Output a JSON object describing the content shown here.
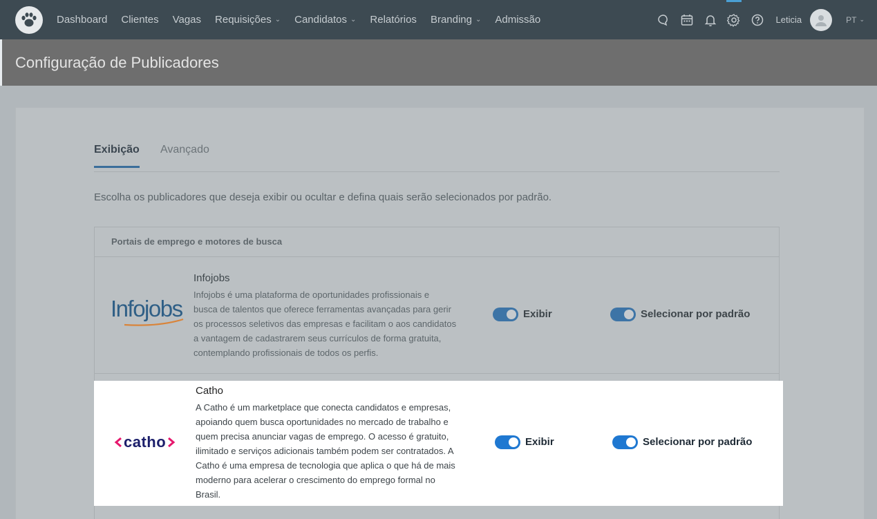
{
  "nav": {
    "items": [
      {
        "label": "Dashboard",
        "dropdown": false
      },
      {
        "label": "Clientes",
        "dropdown": false
      },
      {
        "label": "Vagas",
        "dropdown": false
      },
      {
        "label": "Requisições",
        "dropdown": true
      },
      {
        "label": "Candidatos",
        "dropdown": true
      },
      {
        "label": "Relatórios",
        "dropdown": false
      },
      {
        "label": "Branding",
        "dropdown": true
      },
      {
        "label": "Admissão",
        "dropdown": false
      }
    ],
    "icons": [
      "chat-icon",
      "calendar-icon",
      "bell-icon",
      "gear-icon",
      "help-icon"
    ],
    "user_name": "Leticia",
    "language": "PT"
  },
  "page": {
    "title": "Configuração de Publicadores"
  },
  "tabs": {
    "active": "Exibição",
    "inactive": "Avançado"
  },
  "description": "Escolha os publicadores que deseja exibir ou ocultar e defina quais serão selecionados por padrão.",
  "section": {
    "title": "Portais de emprego e motores de busca",
    "publishers": [
      {
        "name": "Infojobs",
        "logo_text": "Infojobs",
        "description_lines": [
          "Infojobs é uma plataforma de oportunidades profissionais e",
          "busca de talentos que oferece ferramentas avançadas para gerir",
          "os processos seletivos das empresas e facilitam o aos candidatos",
          "a vantagem de cadastrarem seus currículos de forma gratuita,",
          "contemplando profissionais de todos os perfis."
        ],
        "show_label": "Exibir",
        "show_on": true,
        "default_label": "Selecionar por padrão",
        "default_on": true
      },
      {
        "name": "Catho",
        "logo_text": "catho",
        "description_lines": [
          "A Catho é um marketplace que conecta candidatos e empresas,",
          "apoiando quem busca oportunidades no mercado de trabalho e",
          "quem precisa anunciar vagas de emprego. O acesso é gratuito,",
          "ilimitado e serviços adicionais também podem ser contratados. A",
          "Catho é uma empresa de tecnologia que aplica o que há de mais",
          "moderno para acelerar o crescimento do emprego formal no",
          "Brasil."
        ],
        "show_label": "Exibir",
        "show_on": true,
        "default_label": "Selecionar por padrão",
        "default_on": true
      }
    ]
  },
  "colors": {
    "nav_bg": "#3d4a52",
    "accent_blue": "#1f78d1",
    "catho_pink": "#e6186d",
    "catho_navy": "#1c1f6b",
    "infojobs_blue": "#2c5d86",
    "infojobs_orange": "#e8822a"
  }
}
